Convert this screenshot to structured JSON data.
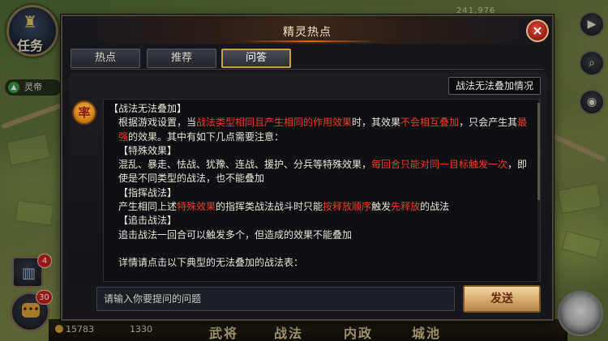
{
  "hud": {
    "coords": "241,976",
    "task_label": "任务",
    "lord_name": "灵帝",
    "chat_badge": "30",
    "book_badge": "4",
    "copper": "15783",
    "food": "1330",
    "nav": [
      "武将",
      "战法",
      "内政",
      "城池"
    ]
  },
  "dialog": {
    "title": "精灵热点",
    "close_label": "×",
    "tabs": [
      {
        "label": "热点",
        "active": false
      },
      {
        "label": "推荐",
        "active": false
      },
      {
        "label": "问答",
        "active": true
      }
    ],
    "topic": "战法无法叠加情况",
    "avatar_glyph": "率",
    "answer": {
      "heading": "【战法无法叠加】",
      "p1_a": "根据游戏设置，当",
      "p1_b": "战法类型相同且产生相同的作用效果",
      "p1_c": "时，其效果",
      "p1_d": "不会相互叠加",
      "p1_e": "，只会产生其",
      "p1_f": "最强",
      "p1_g": "的效果。其中有如下几点需要注意：",
      "s1_head": "【特殊效果】",
      "s1_a": "混乱、暴走、怯战、犹豫、连战、援护、分兵等特殊效果，",
      "s1_b": "每回合只能对同一目标触发一次",
      "s1_c": "，即使是不同类型的战法，也不能叠加",
      "s2_head": "【指挥战法】",
      "s2_a": "产生相同上述",
      "s2_b": "特殊效果",
      "s2_c": "的指挥类战法战斗时只能",
      "s2_d": "按释放顺序",
      "s2_e": "触发",
      "s2_f": "先释放",
      "s2_g": "的战法",
      "s3_head": "【追击战法】",
      "s3_a": "追击战法一回合可以触发多个，但造成的效果不能叠加",
      "tail": "详情请点击以下典型的无法叠加的战法表："
    },
    "input_placeholder": "请输入你要提问的问题",
    "send_label": "发送"
  },
  "colors": {
    "accent_red": "#ee3b2a",
    "tab_active_border": "#c99f44",
    "send_button": "#d7a96a"
  }
}
